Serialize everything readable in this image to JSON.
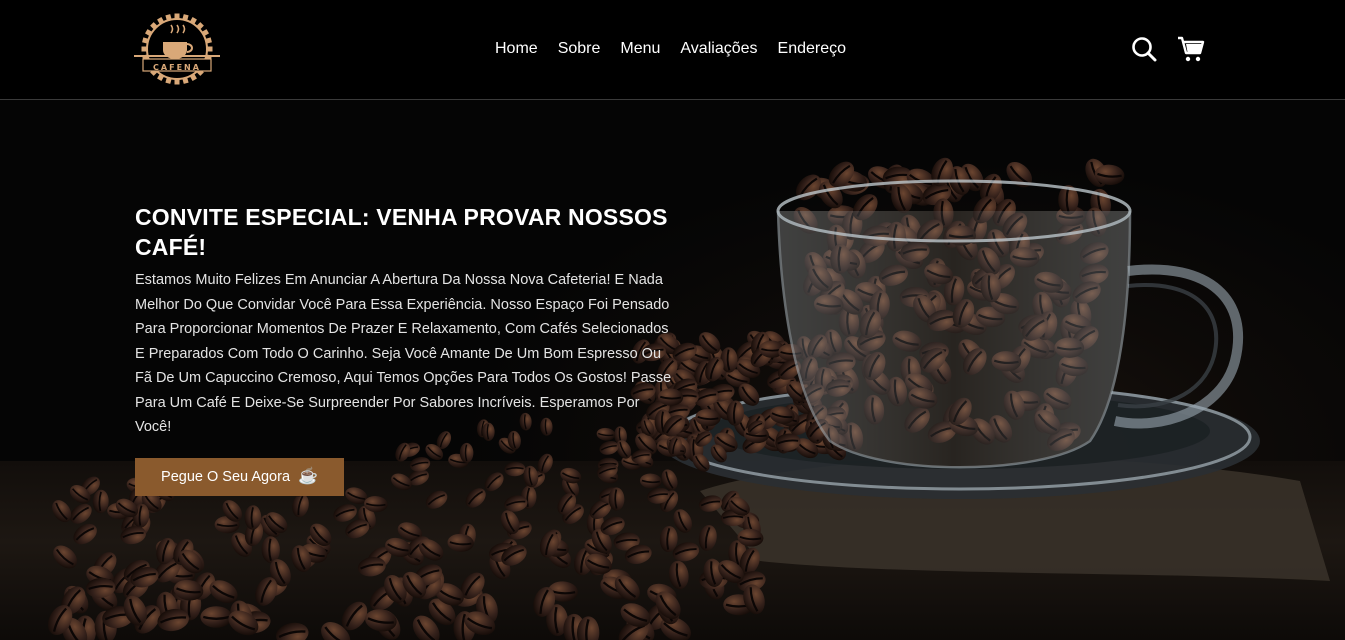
{
  "brand": {
    "logo_text": "CAFENA"
  },
  "nav": {
    "items": [
      {
        "label": "Home"
      },
      {
        "label": "Sobre"
      },
      {
        "label": "Menu"
      },
      {
        "label": "Avaliações"
      },
      {
        "label": "Endereço"
      }
    ]
  },
  "header_icons": {
    "search": "search-icon",
    "cart": "cart-icon"
  },
  "hero": {
    "title": "CONVITE ESPECIAL: VENHA PROVAR NOSSOS CAFÉ!",
    "text": "Estamos Muito Felizes Em Anunciar A Abertura Da Nossa Nova Cafeteria! E Nada Melhor Do Que Convidar Você Para Essa Experiência. Nosso Espaço Foi Pensado Para Proporcionar Momentos De Prazer E Relaxamento, Com Cafés Selecionados E Preparados Com Todo O Carinho. Seja Você Amante De Um Bom Espresso Ou Fã De Um Capuccino Cremoso, Aqui Temos Opções Para Todos Os Gostos! Passe Para Um Café E Deixe-Se Surpreender Por Sabores Incríveis. Esperamos Por Você!",
    "cta_label": "Pegue O Seu Agora",
    "cta_icon": "☕"
  },
  "colors": {
    "accent": "#8a5a2d",
    "header_bg": "#000000",
    "logo": "#d9a878"
  }
}
